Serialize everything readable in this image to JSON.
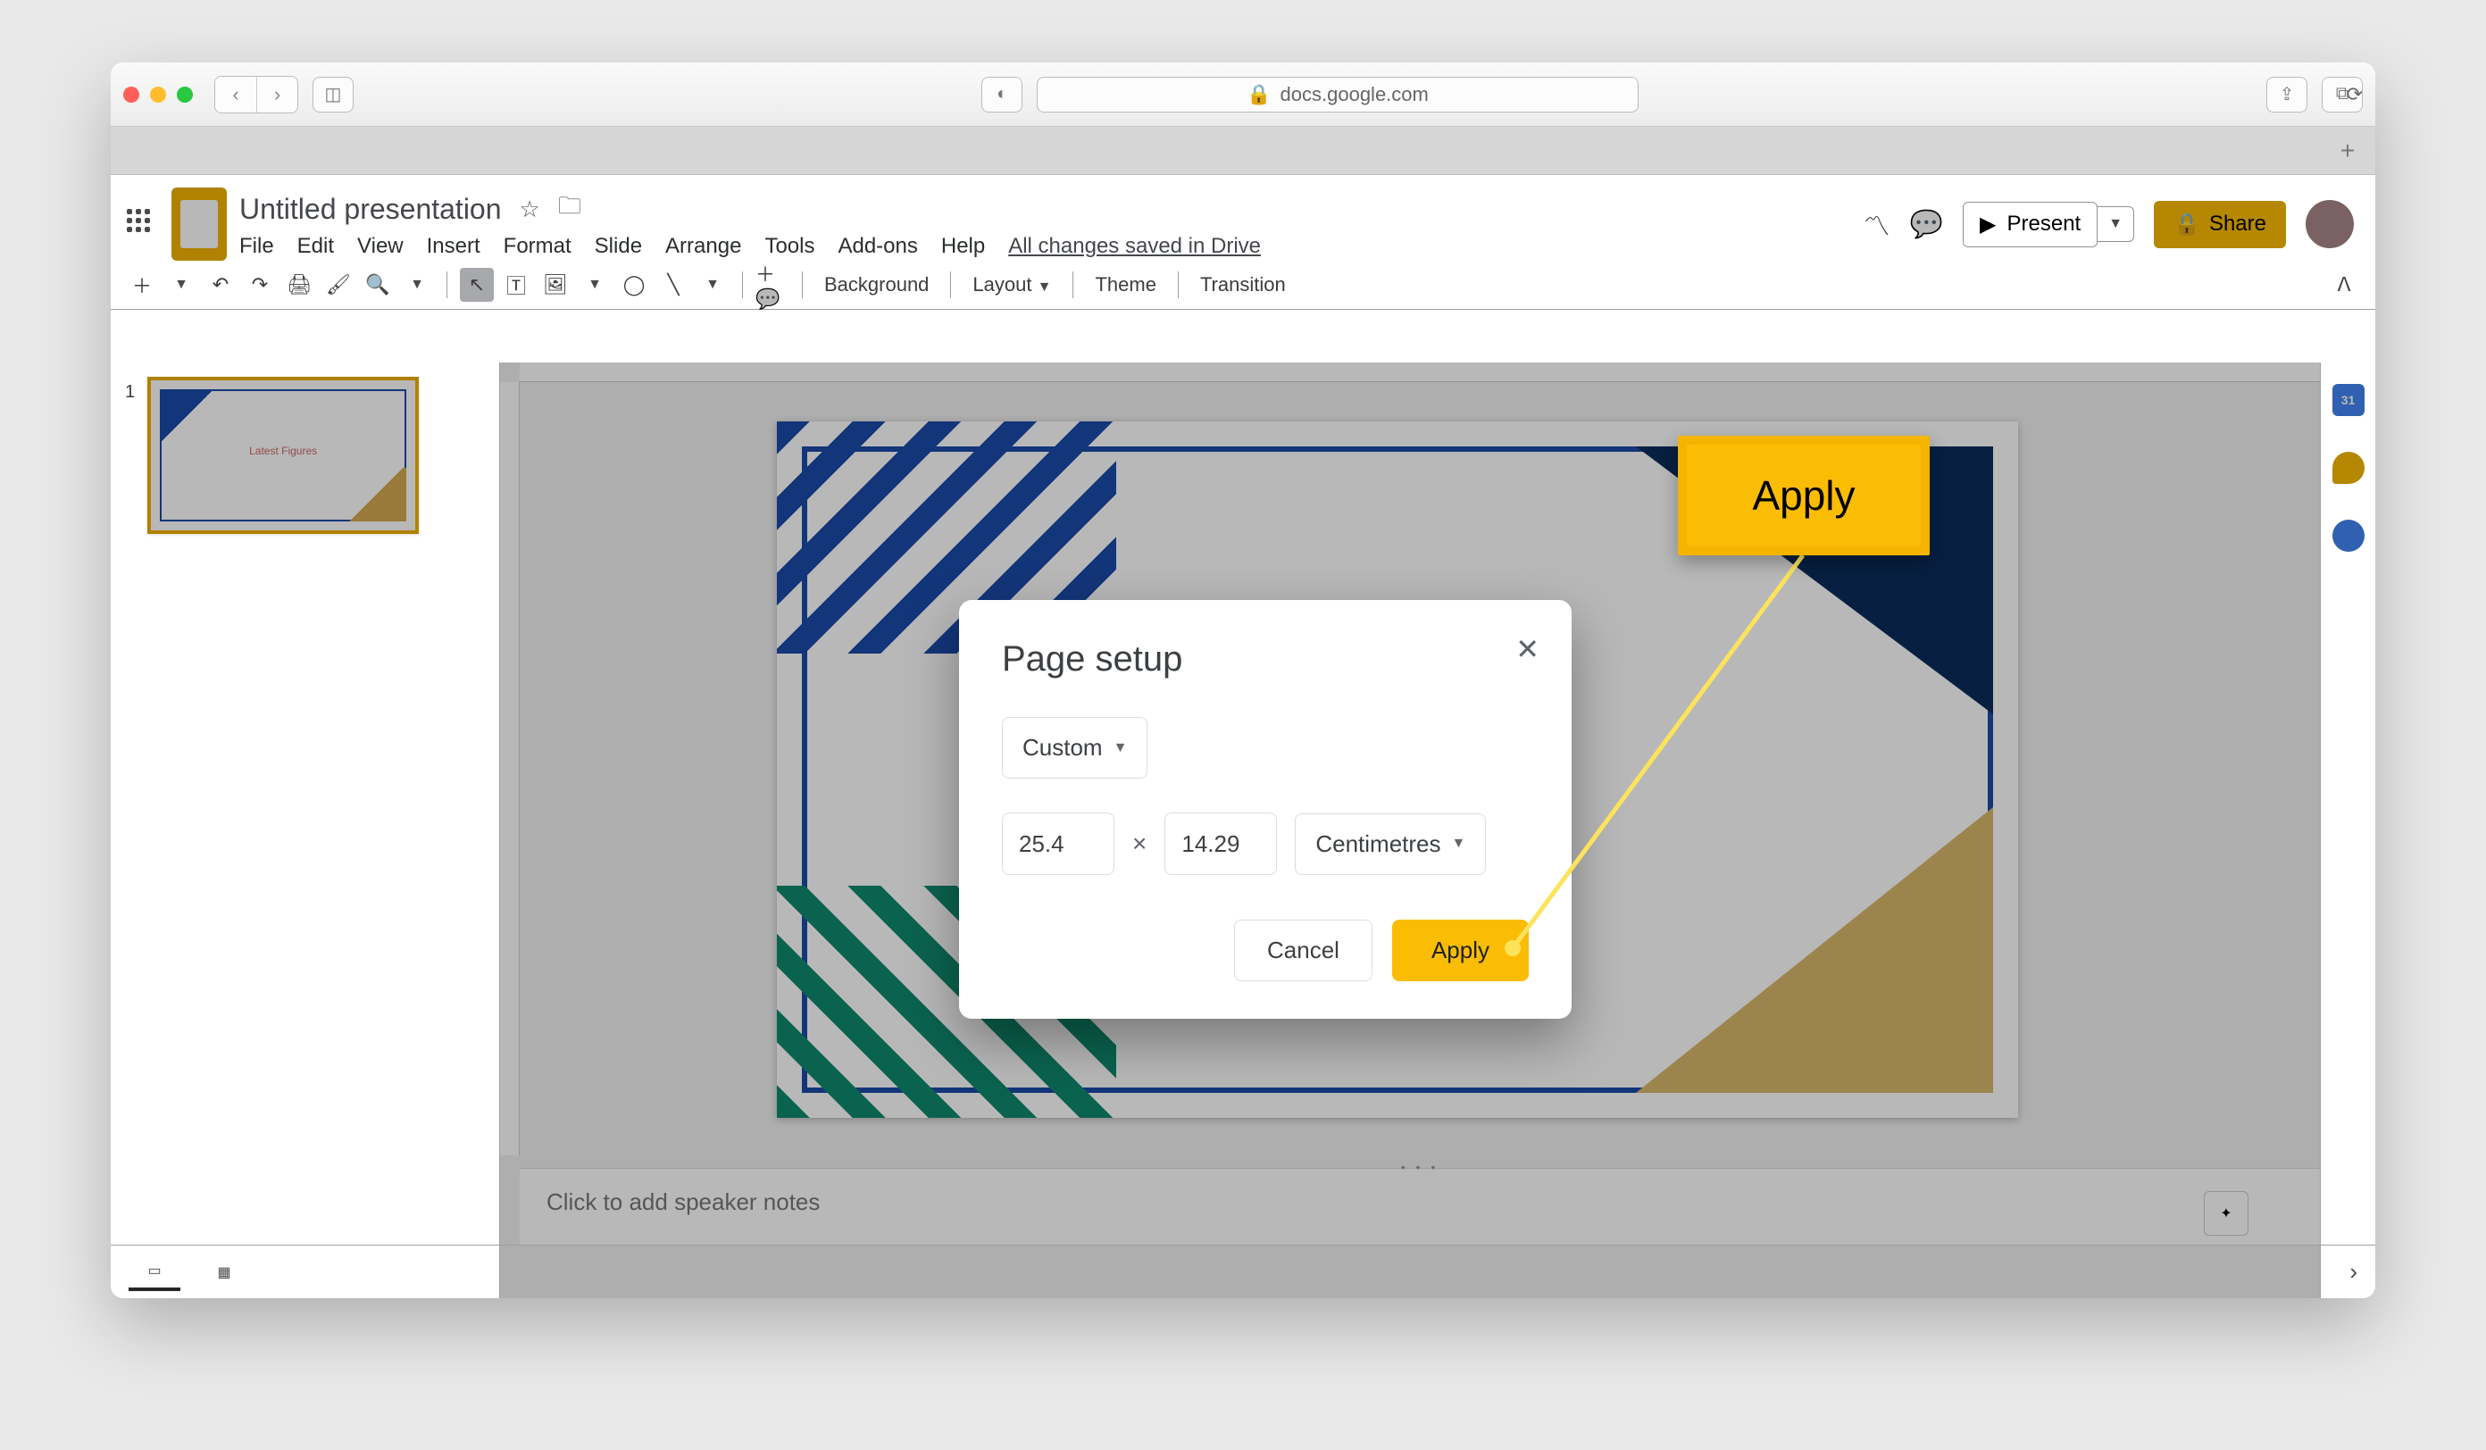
{
  "browser": {
    "url": "docs.google.com"
  },
  "doc": {
    "title": "Untitled presentation",
    "drive_status": "All changes saved in Drive"
  },
  "menus": {
    "file": "File",
    "edit": "Edit",
    "view": "View",
    "insert": "Insert",
    "format": "Format",
    "slide": "Slide",
    "arrange": "Arrange",
    "tools": "Tools",
    "addons": "Add-ons",
    "help": "Help"
  },
  "header_buttons": {
    "present": "Present",
    "share": "Share"
  },
  "toolbar": {
    "background": "Background",
    "layout": "Layout",
    "theme": "Theme",
    "transition": "Transition"
  },
  "thumbs": {
    "one": {
      "number": "1",
      "title": "Latest Figures"
    }
  },
  "notes": {
    "placeholder": "Click to add speaker notes"
  },
  "sidepanel": {
    "calendar_day": "31"
  },
  "dialog": {
    "title": "Page setup",
    "size_mode": "Custom",
    "width": "25.4",
    "height": "14.29",
    "separator": "×",
    "unit": "Centimetres",
    "cancel": "Cancel",
    "apply": "Apply"
  },
  "callout": {
    "label": "Apply"
  }
}
